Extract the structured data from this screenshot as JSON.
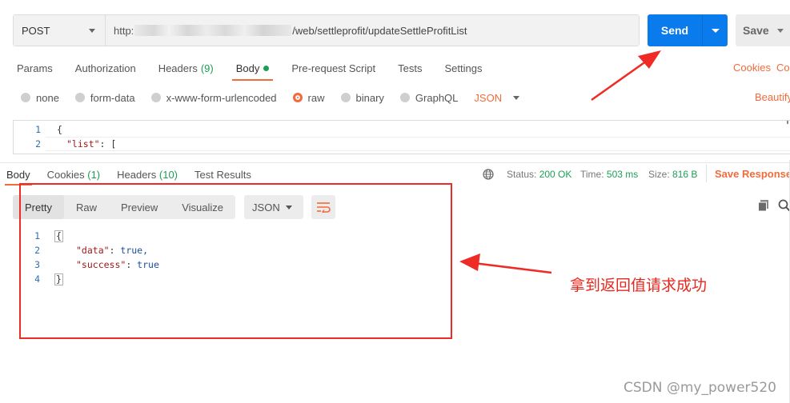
{
  "request": {
    "method": "POST",
    "url_prefix": "http:",
    "url_suffix": "/web/settleprofit/updateSettleProfitList",
    "send_label": "Send",
    "save_label": "Save"
  },
  "request_tabs": [
    {
      "label": "Params"
    },
    {
      "label": "Authorization"
    },
    {
      "label": "Headers",
      "count": "(9)"
    },
    {
      "label": "Body"
    },
    {
      "label": "Pre-request Script"
    },
    {
      "label": "Tests"
    },
    {
      "label": "Settings"
    }
  ],
  "links": {
    "cookies": "Cookies",
    "code": "Coc",
    "beautify": "Beautify"
  },
  "body_types": [
    "none",
    "form-data",
    "x-www-form-urlencoded",
    "raw",
    "binary",
    "GraphQL"
  ],
  "body_format": "JSON",
  "request_body": {
    "line1_no": "1",
    "line1": "{",
    "line2_no": "2",
    "line2_key": "\"list\"",
    "line2_rest": ": ["
  },
  "response_tabs": [
    {
      "label": "Body"
    },
    {
      "label": "Cookies",
      "count": "(1)"
    },
    {
      "label": "Headers",
      "count": "(10)"
    },
    {
      "label": "Test Results"
    }
  ],
  "response_meta": {
    "status_label": "Status:",
    "status_value": "200 OK",
    "time_label": "Time:",
    "time_value": "503 ms",
    "size_label": "Size:",
    "size_value": "816 B",
    "save_response": "Save Response"
  },
  "view_modes": [
    "Pretty",
    "Raw",
    "Preview",
    "Visualize"
  ],
  "response_format": "JSON",
  "response_body": {
    "l1": "1",
    "l2": "2",
    "l3": "3",
    "l4": "4",
    "open": "{",
    "data_key": "\"data\"",
    "data_val": "true,",
    "success_key": "\"success\"",
    "success_val": "true",
    "close": "}"
  },
  "annotation": "拿到返回值请求成功",
  "watermark": "CSDN @my_power520",
  "colors": {
    "accent": "#f26b3a",
    "send": "#097bed",
    "success": "#1d9e55",
    "annotation": "#ee2b24"
  }
}
